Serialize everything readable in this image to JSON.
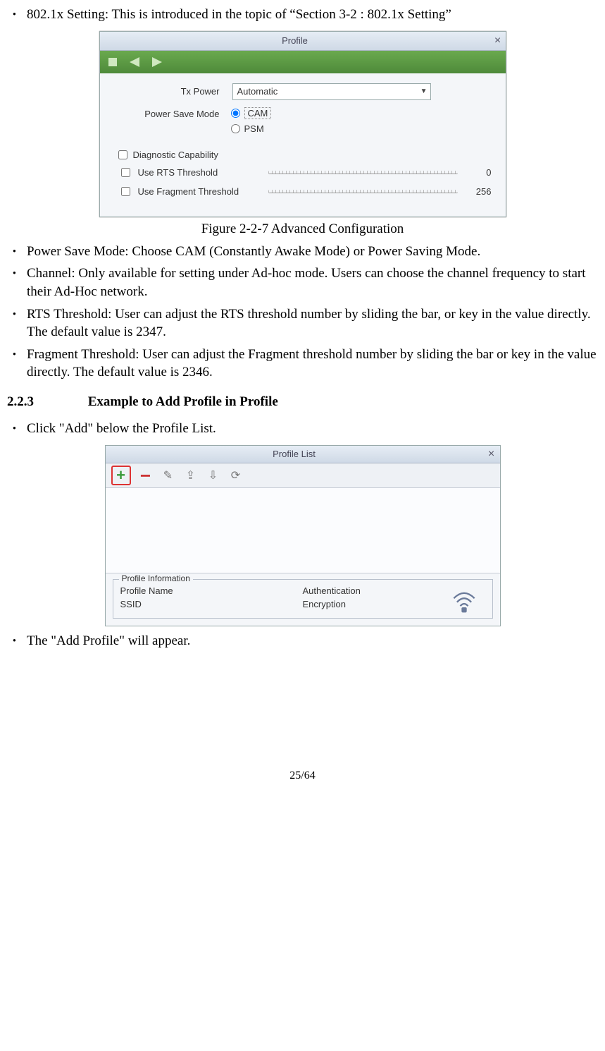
{
  "bullets_top": [
    "802.1x Setting: This is introduced in the topic of “Section 3-2 : 802.1x Setting”"
  ],
  "fig1": {
    "title": "Profile",
    "tx_power_label": "Tx Power",
    "tx_power_value": "Automatic",
    "psm_label": "Power Save Mode",
    "radio_cam": "CAM",
    "radio_psm": "PSM",
    "chk_diag": "Diagnostic Capability",
    "chk_rts": "Use RTS Threshold",
    "rts_val": "0",
    "chk_frag": "Use Fragment Threshold",
    "frag_val": "256",
    "caption": "Figure 2-2-7 Advanced Configuration"
  },
  "bullets_mid": [
    "Power Save Mode: Choose CAM (Constantly Awake Mode) or Power Saving Mode.",
    "Channel: Only available for setting under Ad-hoc mode. Users can choose the channel frequency to start their Ad-Hoc network.",
    "RTS Threshold: User can adjust the RTS threshold number by sliding the bar, or key in the value directly. The default value is 2347.",
    "Fragment Threshold: User can adjust the Fragment threshold number by sliding the bar or key in the value directly. The default value is 2346."
  ],
  "section": {
    "num": "2.2.3",
    "title": "Example to Add Profile in Profile"
  },
  "bullets_bot1": [
    "Click \"Add\" below the Profile List."
  ],
  "fig2": {
    "title": "Profile List",
    "legend": "Profile Information",
    "pn": "Profile Name",
    "ssid": "SSID",
    "auth": "Authentication",
    "enc": "Encryption"
  },
  "bullets_bot2": [
    "The \"Add Profile\" will appear."
  ],
  "pageno": "25/64"
}
